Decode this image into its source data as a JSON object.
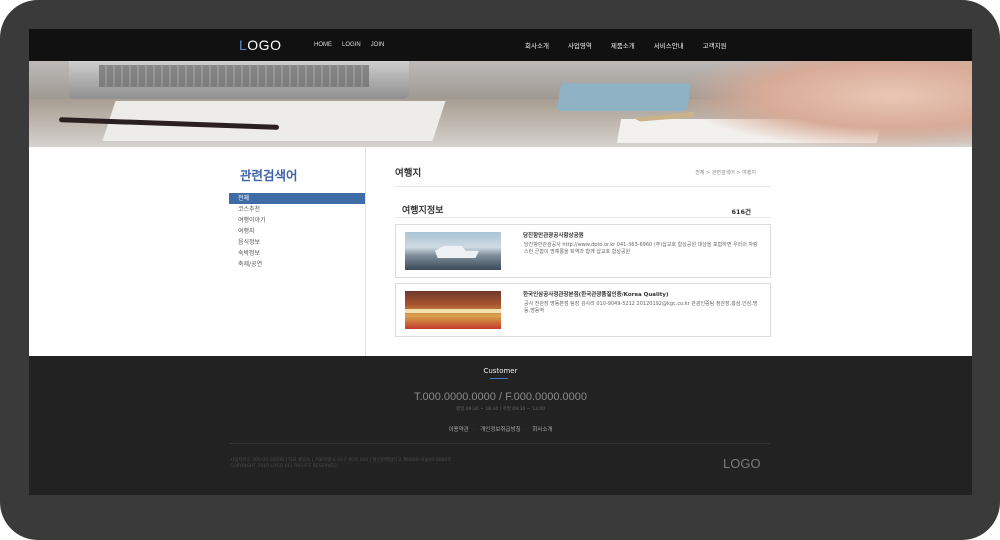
{
  "header": {
    "logo_first": "L",
    "logo_rest": "OGO",
    "util_links": [
      "HOME",
      "LOGIN",
      "JOIN"
    ],
    "gnb": [
      "회사소개",
      "사업영역",
      "제품소개",
      "서비스안내",
      "고객지원"
    ]
  },
  "sidebar": {
    "title": "관련검색어",
    "items": [
      "전체",
      "코스추천",
      "여행이야기",
      "여행지",
      "음식정보",
      "숙박정보",
      "축제/공연"
    ]
  },
  "main": {
    "title": "여행지",
    "breadcrumb": "전체 > 관련검색어 > 여행지",
    "section_title": "여행지정보",
    "count": "616건",
    "results": [
      {
        "title": "당진항만관광공사함상공원",
        "description": "당진항만관광공사 http://www.dpto.or.kr 041-363-6960 (주)삽교호 함상공원 대상을 포함하면 우리의 자랑스런 군함이 명예롭을 퇴역과 함께 삽교호 함상공원"
      },
      {
        "title": "한국인삼공사정관장본점(한국관광품질인증/Korea Quality)",
        "description": "공사 전관장 명동본점 팀장 김사라 010-9049-5212 20120192@kgc.co.kr 관광인증팀 정관장,홍삼,인삼,명동,명동역"
      }
    ]
  },
  "footer": {
    "label": "Customer",
    "phone": "T.000.0000.0000 / F.000.0000.0000",
    "hours": "평일 09:30 ~ 18:30 / 주말 09:30 ~ 13:00",
    "links": [
      "이용약관",
      "개인정보취급방침",
      "회사소개"
    ],
    "address": "사업자번호 000-00-00000 | 대표 홍길동 | 서울특별시 00구 00로 000 | 통신판매업신고 제0000-서울00-0000호",
    "copyright": "COPYRIGHT 2019 LOGO ALL RIGHTS RESERVED.",
    "logo": "LOGO"
  },
  "colors": {
    "accent": "#3f6ba6",
    "topbar": "#111111",
    "footer": "#222222",
    "frame": "#3a3a3a"
  }
}
